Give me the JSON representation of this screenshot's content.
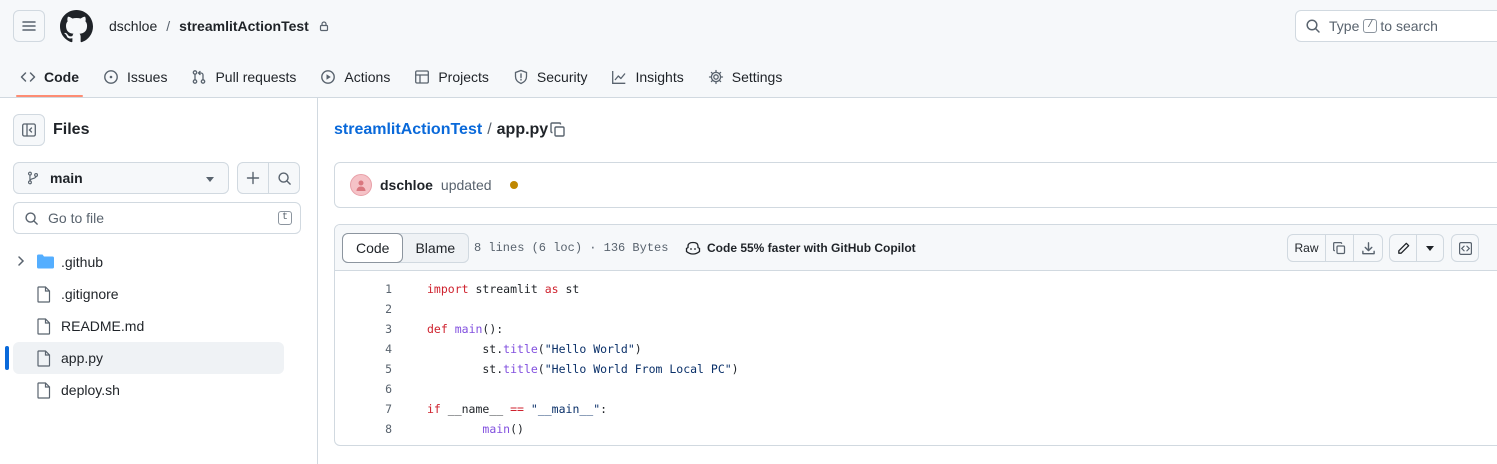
{
  "header": {
    "owner": "dschloe",
    "separator": "/",
    "repo": "streamlitActionTest",
    "search": {
      "prefix": "Type",
      "key": "/",
      "suffix": "to search"
    }
  },
  "tabs": [
    {
      "label": "Code",
      "icon": "code-icon",
      "active": true
    },
    {
      "label": "Issues",
      "icon": "issue-opened-icon"
    },
    {
      "label": "Pull requests",
      "icon": "git-pull-request-icon"
    },
    {
      "label": "Actions",
      "icon": "play-icon"
    },
    {
      "label": "Projects",
      "icon": "table-icon"
    },
    {
      "label": "Security",
      "icon": "shield-icon"
    },
    {
      "label": "Insights",
      "icon": "graph-icon"
    },
    {
      "label": "Settings",
      "icon": "gear-icon"
    }
  ],
  "sidebar": {
    "title": "Files",
    "branch": "main",
    "goto_placeholder": "Go to file",
    "goto_key": "t",
    "tree": [
      {
        "label": ".github",
        "type": "folder"
      },
      {
        "label": ".gitignore",
        "type": "file"
      },
      {
        "label": "README.md",
        "type": "file"
      },
      {
        "label": "app.py",
        "type": "file",
        "selected": true
      },
      {
        "label": "deploy.sh",
        "type": "file"
      }
    ]
  },
  "path": {
    "repo": "streamlitActionTest",
    "separator": "/",
    "file": "app.py"
  },
  "commit": {
    "author": "dschloe",
    "message": "updated",
    "status_color": "#bf8700"
  },
  "file_view": {
    "code_tab": "Code",
    "blame_tab": "Blame",
    "meta": "8 lines (6 loc) · 136 Bytes",
    "copilot": "Code 55% faster with GitHub Copilot",
    "raw_label": "Raw"
  },
  "code_lines": [
    {
      "n": "1",
      "text": "import streamlit as st"
    },
    {
      "n": "2",
      "text": ""
    },
    {
      "n": "3",
      "text": "def main():"
    },
    {
      "n": "4",
      "text": "        st.title(\"Hello World\")"
    },
    {
      "n": "5",
      "text": "        st.title(\"Hello World From Local PC\")"
    },
    {
      "n": "6",
      "text": ""
    },
    {
      "n": "7",
      "text": "if __name__ == \"__main__\":"
    },
    {
      "n": "8",
      "text": "        main()"
    }
  ],
  "colors": {
    "accent": "#0969da",
    "tab_underline": "#fd8c73",
    "keyword": "#cf222e",
    "function": "#8250df",
    "string": "#0a3069"
  }
}
